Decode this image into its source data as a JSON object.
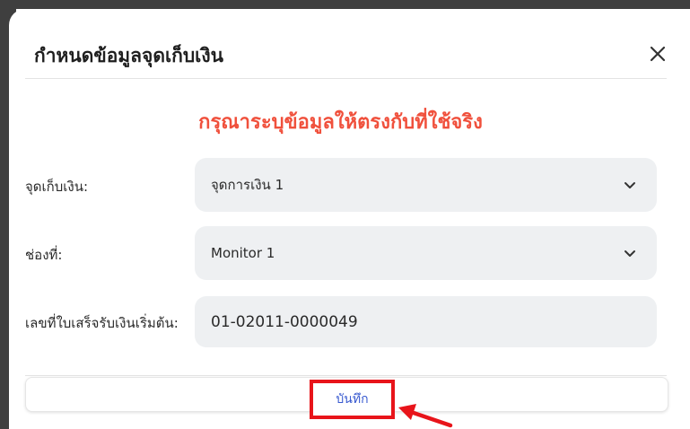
{
  "dialog": {
    "title": "กำหนดข้อมูลจุดเก็บเงิน",
    "close_icon": "close-icon"
  },
  "warning": {
    "text": "กรุณาระบุข้อมูลให้ตรงกับที่ใช้จริง",
    "color": "#f0503c"
  },
  "form": {
    "cash_point": {
      "label": "จุดเก็บเงิน:",
      "value": "จุดการเงิน 1"
    },
    "channel": {
      "label": "ช่องที่:",
      "value": "Monitor 1"
    },
    "receipt_start": {
      "label": "เลขที่ใบเสร็จรับเงินเริ่มต้น:",
      "value": "01-02011-0000049"
    }
  },
  "footer": {
    "save_label": "บันทึก"
  },
  "colors": {
    "highlight": "#e8141a",
    "accent": "#3a5bd0",
    "field_bg": "#eef0f2"
  }
}
